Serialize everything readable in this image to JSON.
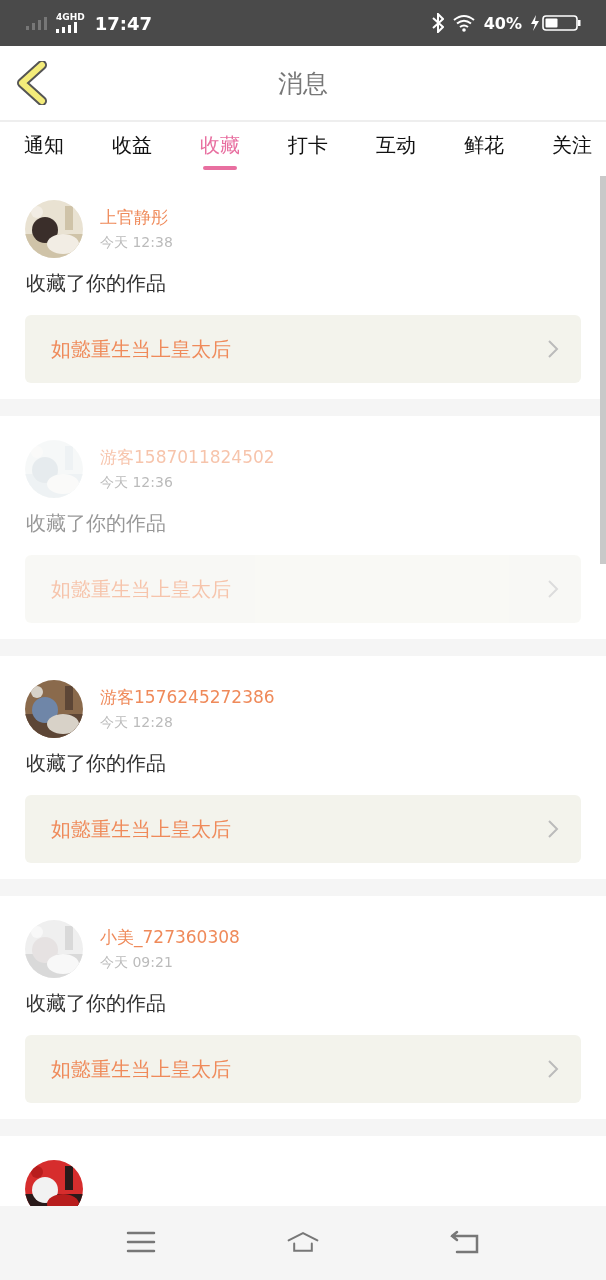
{
  "status_bar": {
    "network": "4G",
    "network_badge": "HD",
    "time": "17:47",
    "battery": "40%"
  },
  "header": {
    "title": "消息"
  },
  "tabs": [
    {
      "label": "通知",
      "selected": false
    },
    {
      "label": "收益",
      "selected": false
    },
    {
      "label": "收藏",
      "selected": true
    },
    {
      "label": "打卡",
      "selected": false
    },
    {
      "label": "互动",
      "selected": false
    },
    {
      "label": "鲜花",
      "selected": false
    },
    {
      "label": "关注",
      "selected": false
    }
  ],
  "messages": [
    {
      "name": "上官静彤",
      "time": "今天 12:38",
      "action": "收藏了你的作品",
      "work": "如懿重生当上皇太后",
      "faded": false
    },
    {
      "name": "游客1587011824502",
      "time": "今天 12:36",
      "action": "收藏了你的作品",
      "work": "如懿重生当上皇太后",
      "faded": true
    },
    {
      "name": "游客1576245272386",
      "time": "今天 12:28",
      "action": "收藏了你的作品",
      "work": "如懿重生当上皇太后",
      "faded": false
    },
    {
      "name": "小美_727360308",
      "time": "今天 09:21",
      "action": "收藏了你的作品",
      "work": "如懿重生当上皇太后",
      "faded": false
    }
  ]
}
